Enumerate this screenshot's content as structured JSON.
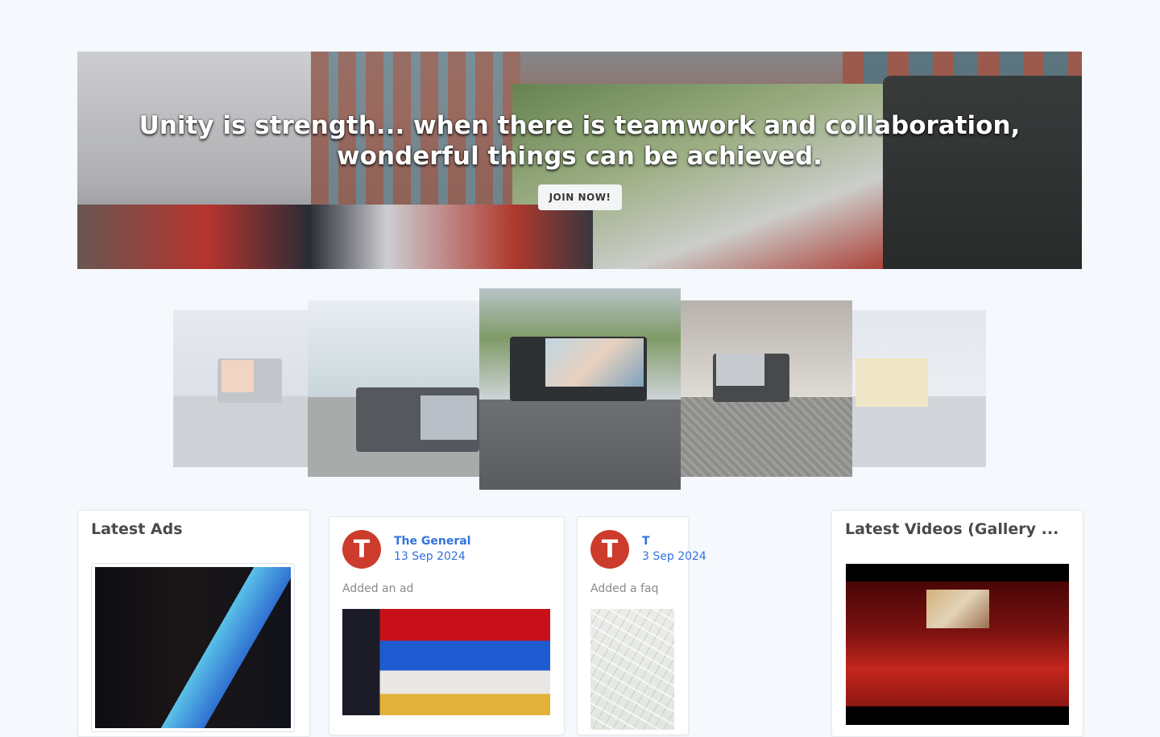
{
  "hero": {
    "headline_line1": "Unity is strength... when there is teamwork and collaboration,",
    "headline_line2": "wonderful things can be achieved.",
    "cta_label": "JOIN NOW!"
  },
  "carousel": {
    "slides": [
      "slide-1",
      "slide-2",
      "slide-3",
      "slide-4",
      "slide-5"
    ]
  },
  "latest_ads": {
    "title": "Latest Ads"
  },
  "feed": [
    {
      "avatar_letter": "T",
      "author": "The General",
      "date": "13 Sep 2024",
      "action": "Added an ad"
    },
    {
      "avatar_letter": "T",
      "author": "T",
      "date": "3 Sep 2024",
      "action": "Added a faq"
    }
  ],
  "latest_videos": {
    "title": "Latest Videos (Gallery ..."
  },
  "colors": {
    "page_background": "#f5f9fd",
    "link_blue": "#3273dc",
    "avatar_red": "#cc3b2b"
  }
}
